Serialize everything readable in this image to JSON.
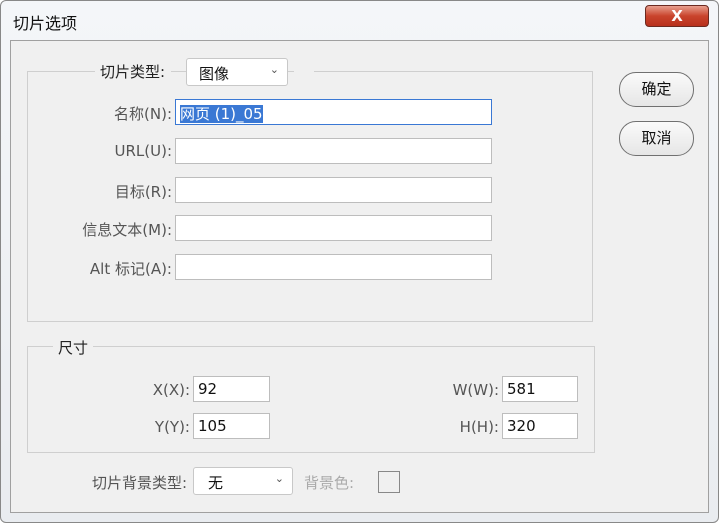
{
  "window": {
    "title": "切片选项",
    "close_label": "X"
  },
  "slice_type": {
    "label": "切片类型:",
    "value": "图像"
  },
  "fields": [
    {
      "label": "名称(N):",
      "value": "网页 (1)_05"
    },
    {
      "label": "URL(U):",
      "value": ""
    },
    {
      "label": "目标(R):",
      "value": ""
    },
    {
      "label": "信息文本(M):",
      "value": ""
    },
    {
      "label": "Alt 标记(A):",
      "value": ""
    }
  ],
  "buttons": {
    "ok": "确定",
    "cancel": "取消"
  },
  "dimensions": {
    "legend": "尺寸",
    "x": {
      "label": "X(X):",
      "value": "92"
    },
    "y": {
      "label": "Y(Y):",
      "value": "105"
    },
    "w": {
      "label": "W(W):",
      "value": "581"
    },
    "h": {
      "label": "H(H):",
      "value": "320"
    }
  },
  "background": {
    "type_label": "切片背景类型:",
    "type_value": "无",
    "color_label": "背景色:"
  }
}
